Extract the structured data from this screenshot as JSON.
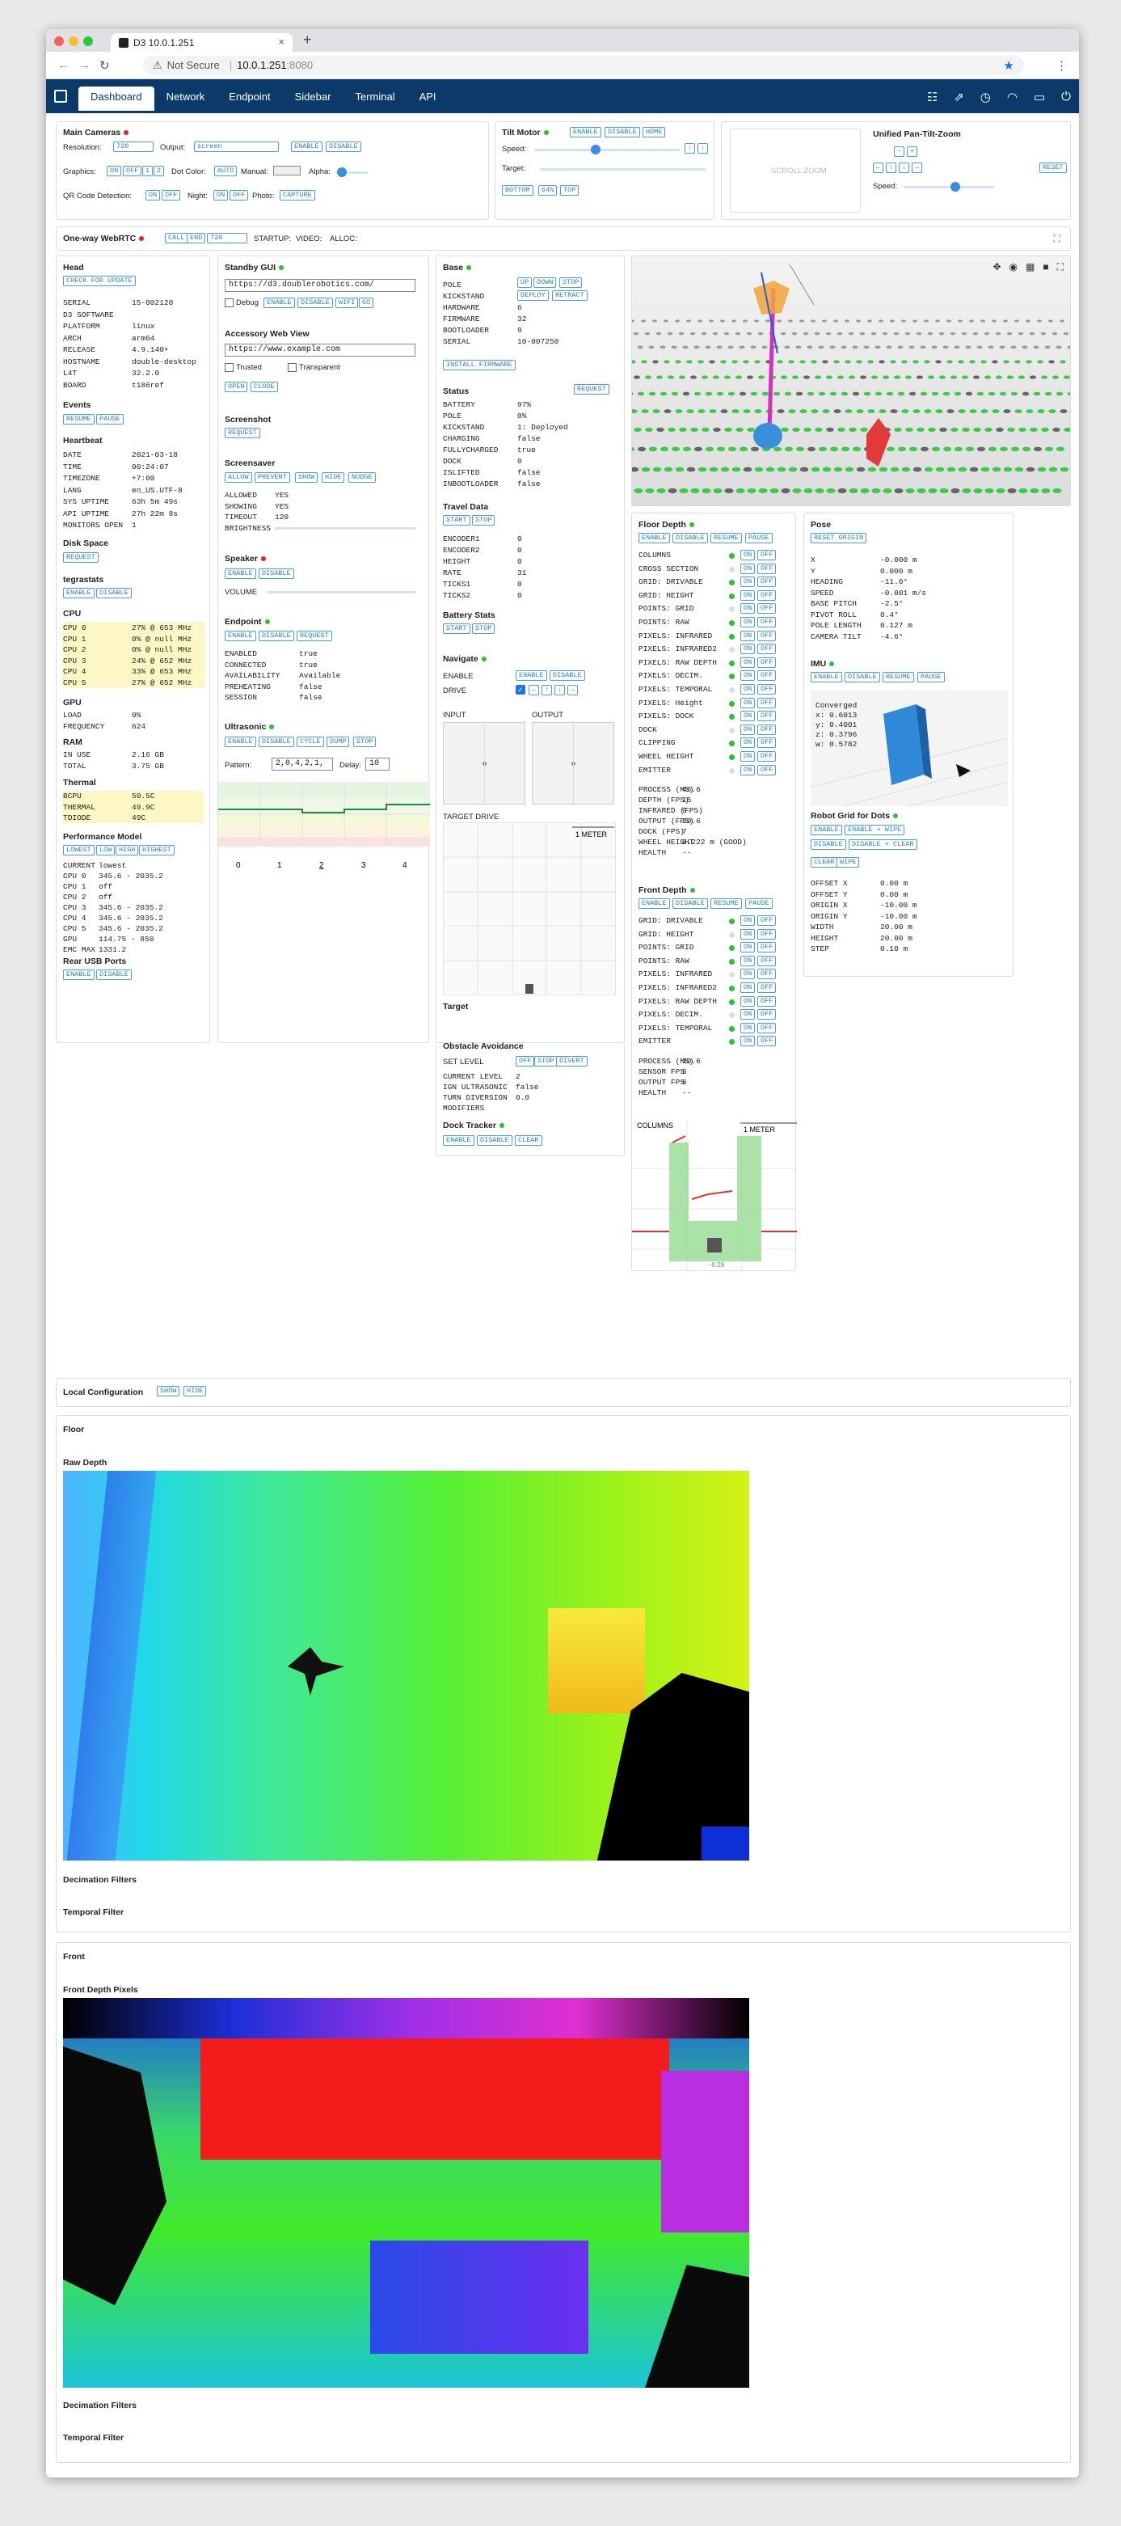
{
  "browser": {
    "tab_title": "D3 10.0.1.251",
    "url_warning": "Not Secure",
    "url_host": "10.0.1.251",
    "url_port": ":8080"
  },
  "nav": {
    "tabs": [
      "Dashboard",
      "Network",
      "Endpoint",
      "Sidebar",
      "Terminal",
      "API"
    ]
  },
  "main_cameras": {
    "title": "Main Cameras",
    "resolution_label": "Resolution:",
    "resolution": "720",
    "output_label": "Output:",
    "output": "screen",
    "enable": "ENABLE",
    "disable": "DISABLE",
    "graphics_label": "Graphics:",
    "on": "ON",
    "off": "OFF",
    "g1": "1",
    "g2": "2",
    "dot_color_label": "Dot Color:",
    "auto": "AUTO",
    "manual_label": "Manual:",
    "alpha_label": "Alpha:",
    "qr_label": "QR Code Detection:",
    "night_label": "Night:",
    "photo_label": "Photo:",
    "capture": "CAPTURE"
  },
  "tilt": {
    "title": "Tilt Motor",
    "enable": "ENABLE",
    "disable": "DISABLE",
    "home": "HOME",
    "speed_label": "Speed:",
    "target_label": "Target:",
    "bottom": "BOTTOM",
    "p64": "64%",
    "top": "TOP"
  },
  "pan": {
    "title": "Unified Pan-Tilt-Zoom",
    "scroll_zoom": "SCROLL ZOOM",
    "minus": "−",
    "plus": "+",
    "reset": "RESET",
    "speed_label": "Speed:"
  },
  "webrtc": {
    "title": "One-way WebRTC",
    "call": "CALL",
    "end": "END",
    "res": "720",
    "startup": "STARTUP:",
    "video": "VIDEO:",
    "alloc": "ALLOC:"
  },
  "head": {
    "title": "Head",
    "check_update": "CHECK FOR UPDATE",
    "rows": [
      [
        "SERIAL",
        "15-002120"
      ],
      [
        "D3 SOFTWARE",
        ""
      ],
      [
        "PLATFORM",
        "linux"
      ],
      [
        "ARCH",
        "arm64"
      ],
      [
        "RELEASE",
        "4.9.140+"
      ],
      [
        "HOSTNAME",
        "double-desktop"
      ],
      [
        "L4T",
        "32.2.0"
      ],
      [
        "BOARD",
        "t186ref"
      ]
    ],
    "events_title": "Events",
    "resume": "RESUME",
    "pause": "PAUSE",
    "heartbeat_title": "Heartbeat",
    "heartbeat": [
      [
        "DATE",
        "2021-03-18"
      ],
      [
        "TIME",
        "00:24:07"
      ],
      [
        "TIMEZONE",
        "+7:00"
      ],
      [
        "LANG",
        "en_US.UTF-8"
      ],
      [
        "SYS UPTIME",
        "63h 5m 49s"
      ],
      [
        "API UPTIME",
        "27h 22m 8s"
      ],
      [
        "MONITORS OPEN",
        "1"
      ]
    ],
    "disk_title": "Disk Space",
    "request": "REQUEST",
    "tegra_title": "tegrastats",
    "enable": "ENABLE",
    "disable": "DISABLE",
    "cpu_title": "CPU",
    "cpu": [
      [
        "CPU 0",
        "27% @ 653 MHz"
      ],
      [
        "CPU 1",
        "0% @ null MHz"
      ],
      [
        "CPU 2",
        "0% @ null MHz"
      ],
      [
        "CPU 3",
        "24% @ 652 MHz"
      ],
      [
        "CPU 4",
        "33% @ 653 MHz"
      ],
      [
        "CPU 5",
        "27% @ 652 MHz"
      ]
    ],
    "gpu_title": "GPU",
    "gpu": [
      [
        "LOAD",
        "0%"
      ],
      [
        "FREQUENCY",
        "624"
      ]
    ],
    "ram_title": "RAM",
    "ram": [
      [
        "IN USE",
        "2.16 GB"
      ],
      [
        "TOTAL",
        "3.75 GB"
      ]
    ],
    "thermal_title": "Thermal",
    "thermal": [
      [
        "BCPU",
        "50.5C"
      ],
      [
        "THERMAL",
        "49.9C"
      ],
      [
        "TDIODE",
        "49C"
      ]
    ],
    "perf_title": "Performance Model",
    "lowest": "LOWEST",
    "low": "LOW",
    "high": "HIGH",
    "highest": "HIGHEST",
    "perf": [
      [
        "CURRENT",
        "lowest"
      ],
      [
        "CPU 0",
        "345.6 - 2035.2"
      ],
      [
        "CPU 1",
        "off"
      ],
      [
        "CPU 2",
        "off"
      ],
      [
        "CPU 3",
        "345.6 - 2035.2"
      ],
      [
        "CPU 4",
        "345.6 - 2035.2"
      ],
      [
        "CPU 5",
        "345.6 - 2035.2"
      ],
      [
        "GPU",
        "114.75 - 850"
      ],
      [
        "EMC MAX",
        "1331.2"
      ]
    ],
    "usb_title": "Rear USB Ports"
  },
  "standby": {
    "title": "Standby GUI",
    "url": "https://d3.doublerobotics.com/",
    "debug": "Debug",
    "enable": "ENABLE",
    "disable": "DISABLE",
    "wifi": "WIFI",
    "go": "GO",
    "accessory_title": "Accessory Web View",
    "accessory_url": "https://www.example.com",
    "trusted": "Trusted",
    "transparent": "Transparent",
    "open": "OPEN",
    "close": "CLOSE",
    "screenshot_title": "Screenshot",
    "request": "REQUEST",
    "screensaver_title": "Screensaver",
    "allow": "ALLOW",
    "prevent": "PREVENT",
    "show": "SHOW",
    "hide": "HIDE",
    "nudge": "NUDGE",
    "screensaver": [
      [
        "ALLOWED",
        "YES"
      ],
      [
        "SHOWING",
        "YES"
      ],
      [
        "TIMEOUT",
        "120"
      ],
      [
        "BRIGHTNESS",
        ""
      ]
    ],
    "speaker_title": "Speaker",
    "volume": "VOLUME",
    "endpoint_title": "Endpoint",
    "endpoint": [
      [
        "ENABLED",
        "true"
      ],
      [
        "CONNECTED",
        "true"
      ],
      [
        "AVAILABILITY",
        "Available"
      ],
      [
        "PREHEATING",
        "false"
      ],
      [
        "SESSION",
        "false"
      ]
    ],
    "ultra_title": "Ultrasonic",
    "cycle": "CYCLE",
    "dump": "DUMP",
    "stop": "STOP",
    "pattern_label": "Pattern:",
    "pattern": "2,0,4,2,1,",
    "delay_label": "Delay:",
    "delay": "10",
    "ticks": [
      "0",
      "1",
      "2",
      "3",
      "4"
    ]
  },
  "base": {
    "title": "Base",
    "rows": [
      [
        "POLE",
        ""
      ],
      [
        "KICKSTAND",
        ""
      ],
      [
        "HARDWARE",
        "6"
      ],
      [
        "FIRMWARE",
        "32"
      ],
      [
        "BOOTLOADER",
        "9"
      ],
      [
        "SERIAL",
        "10-007250"
      ]
    ],
    "up": "UP",
    "down": "DOWN",
    "stop": "STOP",
    "deploy": "DEPLOY",
    "retract": "RETRACT",
    "install": "INSTALL FIRMWARE",
    "status_title": "Status",
    "request": "REQUEST",
    "status": [
      [
        "BATTERY",
        "97%"
      ],
      [
        "POLE",
        "0%"
      ],
      [
        "KICKSTAND",
        "1: Deployed"
      ],
      [
        "CHARGING",
        "false"
      ],
      [
        "FULLYCHARGED",
        "true"
      ],
      [
        "DOCK",
        "0"
      ],
      [
        "ISLIFTED",
        "false"
      ],
      [
        "INBOOTLOADER",
        "false"
      ]
    ],
    "travel_title": "Travel Data",
    "start": "START",
    "stop2": "STOP",
    "travel": [
      [
        "ENCODER1",
        "0"
      ],
      [
        "ENCODER2",
        "0"
      ],
      [
        "HEIGHT",
        "0"
      ],
      [
        "RATE",
        "31"
      ],
      [
        "TICKS1",
        "0"
      ],
      [
        "TICKS2",
        "0"
      ]
    ],
    "battery_title": "Battery Stats",
    "navigate_title": "Navigate",
    "enable_label": "ENABLE",
    "drive_label": "DRIVE",
    "enable": "ENABLE",
    "disable": "DISABLE",
    "input": "INPUT",
    "output": "OUTPUT",
    "target_drive": "TARGET DRIVE",
    "meter": "1 METER",
    "target_title": "Target",
    "obstacle_title": "Obstacle Avoidance",
    "set_level": "SET LEVEL",
    "off": "OFF",
    "divert": "DIVERT",
    "obstacle": [
      [
        "CURRENT LEVEL",
        "2"
      ],
      [
        "IGN ULTRASONIC",
        "false"
      ],
      [
        "TURN DIVERSION",
        "0.0"
      ],
      [
        "MODIFIERS",
        ""
      ]
    ],
    "dock_title": "Dock Tracker",
    "clear": "CLEAR"
  },
  "floor_depth": {
    "title": "Floor Depth",
    "enable": "ENABLE",
    "disable": "DISABLE",
    "resume": "RESUME",
    "pause": "PAUSE",
    "on": "ON",
    "off": "OFF",
    "items": [
      "COLUMNS",
      "CROSS SECTION",
      "GRID: DRIVABLE",
      "GRID: HEIGHT",
      "POINTS: GRID",
      "POINTS: RAW",
      "PIXELS: INFRARED",
      "PIXELS: INFRARED2",
      "PIXELS: RAW DEPTH",
      "PIXELS: DECIM.",
      "PIXELS: TEMPORAL",
      "PIXELS: Height",
      "PIXELS: DOCK",
      "DOCK",
      "CLIPPING",
      "WHEEL HEIGHT",
      "EMITTER"
    ],
    "status": [
      [
        "PROCESS (MS)",
        "46.6"
      ],
      [
        "DEPTH (FPS)",
        "15"
      ],
      [
        "INFRARED (FPS)",
        "0"
      ],
      [
        "OUTPUT (FPS)",
        "20.6"
      ],
      [
        "DOCK (FPS)",
        "7"
      ],
      [
        "WHEEL HEIGHT",
        "0.222 m (GOOD)"
      ],
      [
        "HEALTH",
        "--"
      ]
    ]
  },
  "front_depth": {
    "title": "Front Depth",
    "items": [
      "GRID: DRIVABLE",
      "GRID: HEIGHT",
      "POINTS: GRID",
      "POINTS: RAW",
      "PIXELS: INFRARED",
      "PIXELS: INFRARED2",
      "PIXELS: RAW DEPTH",
      "PIXELS: DECIM.",
      "PIXELS: TEMPORAL",
      "EMITTER"
    ],
    "status": [
      [
        "PROCESS (MS)",
        "10.6"
      ],
      [
        "SENSOR FPS",
        "6"
      ],
      [
        "OUTPUT FPS",
        "6"
      ],
      [
        "HEALTH",
        "--"
      ]
    ],
    "columns": "COLUMNS",
    "meter": "1 METER",
    "value": "-0.29"
  },
  "pose": {
    "title": "Pose",
    "reset": "RESET ORIGIN",
    "rows": [
      [
        "X",
        "-0.000 m"
      ],
      [
        "Y",
        "0.000 m"
      ],
      [
        "HEADING",
        "-11.0°"
      ],
      [
        "SPEED",
        "-0.001 m/s"
      ],
      [
        "BASE PITCH",
        "-2.5°"
      ],
      [
        "PIVOT ROLL",
        "0.4°"
      ],
      [
        "POLE LENGTH",
        "0.127 m"
      ],
      [
        "CAMERA TILT",
        "-4.6°"
      ]
    ],
    "imu_title": "IMU",
    "imu": [
      "Converged",
      "x: 0.6013",
      "y: 0.4001",
      "z: 0.3796",
      "w: 0.5782"
    ],
    "grid_title": "Robot Grid for Dots",
    "enable_wipe": "ENABLE + WIPE",
    "disable_clear": "DISABLE + CLEAR",
    "clear": "CLEAR",
    "wipe": "WIPE",
    "grid": [
      [
        "OFFSET X",
        "0.00 m"
      ],
      [
        "OFFSET Y",
        "0.00 m"
      ],
      [
        "ORIGIN X",
        "-10.00 m"
      ],
      [
        "ORIGIN Y",
        "-10.00 m"
      ],
      [
        "WIDTH",
        "20.00 m"
      ],
      [
        "HEIGHT",
        "20.00 m"
      ],
      [
        "STEP",
        "0.10 m"
      ]
    ]
  },
  "local": {
    "title": "Local Configuration",
    "show": "SHOW",
    "hide": "HIDE"
  },
  "floor": {
    "title": "Floor",
    "raw": "Raw Depth",
    "decim": "Decimation Filters",
    "temporal": "Temporal Filter"
  },
  "front": {
    "title": "Front",
    "pixels": "Front Depth Pixels",
    "decim": "Decimation Filters",
    "temporal": "Temporal Filter"
  }
}
